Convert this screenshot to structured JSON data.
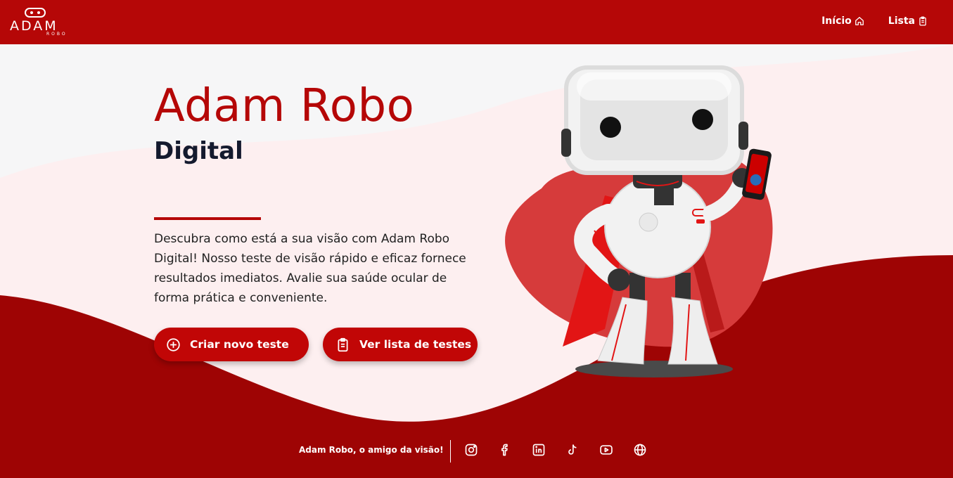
{
  "header": {
    "logo_text": "ADAM",
    "logo_sub": "ROBO",
    "nav": [
      {
        "label": "Início",
        "icon": "home-icon"
      },
      {
        "label": "Lista",
        "icon": "clipboard-icon"
      }
    ]
  },
  "hero": {
    "title": "Adam Robo",
    "subtitle": "Digital",
    "description": "Descubra como está a sua visão com Adam Robo Digital! Nosso teste de visão rápido e eficaz fornece resultados imediatos. Avalie sua saúde ocular de forma prática e conveniente.",
    "buttons": [
      {
        "label": "Criar novo teste",
        "icon": "plus-circle-icon"
      },
      {
        "label": "Ver lista de testes",
        "icon": "clipboard-list-icon"
      }
    ]
  },
  "footer": {
    "slogan": "Adam Robo, o amigo da visão!",
    "socials": [
      "instagram-icon",
      "facebook-icon",
      "linkedin-icon",
      "tiktok-icon",
      "youtube-icon",
      "globe-icon"
    ]
  },
  "colors": {
    "primary": "#b50707",
    "dark_red": "#9b0303",
    "blob": "#d63b3b",
    "heading_dark": "#141a2e",
    "background_light": "#f7f7f8",
    "background_pink": "#fdf0f0"
  }
}
